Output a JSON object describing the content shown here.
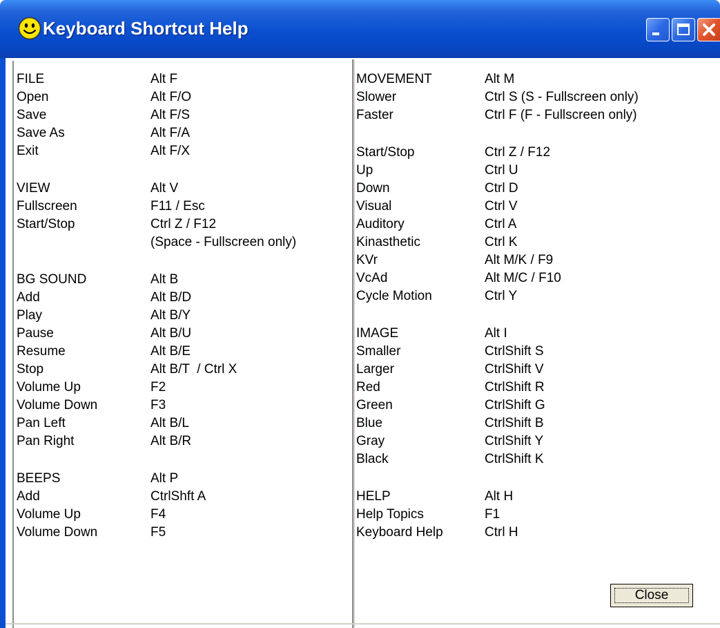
{
  "window": {
    "title": "Keyboard Shortcut Help"
  },
  "buttons": {
    "close_label": "Close"
  },
  "left_column": [
    {
      "name": "FILE",
      "key": "Alt F"
    },
    {
      "name": "Open",
      "key": "Alt F/O"
    },
    {
      "name": "Save",
      "key": "Alt F/S"
    },
    {
      "name": "Save As",
      "key": "Alt F/A"
    },
    {
      "name": "Exit",
      "key": "Alt F/X"
    },
    {
      "name": "VIEW",
      "key": "Alt V"
    },
    {
      "name": "Fullscreen",
      "key": "F11 / Esc"
    },
    {
      "name": "Start/Stop",
      "key": "Ctrl Z / F12"
    },
    {
      "name": "",
      "key": "(Space - Fullscreen only)"
    },
    {
      "name": "BG SOUND",
      "key": "Alt B"
    },
    {
      "name": "Add",
      "key": "Alt B/D"
    },
    {
      "name": "Play",
      "key": "Alt B/Y"
    },
    {
      "name": "Pause",
      "key": "Alt B/U"
    },
    {
      "name": "Resume",
      "key": "Alt B/E"
    },
    {
      "name": "Stop",
      "key": "Alt B/T  / Ctrl X"
    },
    {
      "name": "Volume Up",
      "key": "F2"
    },
    {
      "name": "Volume Down",
      "key": "F3"
    },
    {
      "name": "Pan Left",
      "key": "Alt B/L"
    },
    {
      "name": "Pan Right",
      "key": "Alt B/R"
    },
    {
      "name": "BEEPS",
      "key": "Alt P"
    },
    {
      "name": "Add",
      "key": "CtrlShft A"
    },
    {
      "name": "Volume Up",
      "key": "F4"
    },
    {
      "name": "Volume Down",
      "key": "F5"
    }
  ],
  "right_column": [
    {
      "name": "MOVEMENT",
      "key": "Alt M"
    },
    {
      "name": "Slower",
      "key": "Ctrl S (S - Fullscreen only)"
    },
    {
      "name": "Faster",
      "key": "Ctrl F (F - Fullscreen only)"
    },
    {
      "name": "Start/Stop",
      "key": "Ctrl Z / F12"
    },
    {
      "name": "Up",
      "key": "Ctrl U"
    },
    {
      "name": "Down",
      "key": "Ctrl D"
    },
    {
      "name": "Visual",
      "key": "Ctrl V"
    },
    {
      "name": "Auditory",
      "key": "Ctrl A"
    },
    {
      "name": "Kinasthetic",
      "key": "Ctrl K"
    },
    {
      "name": "KVr",
      "key": "Alt M/K / F9"
    },
    {
      "name": "VcAd",
      "key": "Alt M/C / F10"
    },
    {
      "name": "Cycle Motion",
      "key": "Ctrl Y"
    },
    {
      "name": "IMAGE",
      "key": "Alt I"
    },
    {
      "name": "Smaller",
      "key": "CtrlShift S"
    },
    {
      "name": "Larger",
      "key": "CtrlShift V"
    },
    {
      "name": "Red",
      "key": "CtrlShift R"
    },
    {
      "name": "Green",
      "key": "CtrlShift G"
    },
    {
      "name": "Blue",
      "key": "CtrlShift B"
    },
    {
      "name": "Gray",
      "key": "CtrlShift Y"
    },
    {
      "name": "Black",
      "key": "CtrlShift K"
    },
    {
      "name": "HELP",
      "key": "Alt H"
    },
    {
      "name": "Help Topics",
      "key": "F1"
    },
    {
      "name": "Keyboard Help",
      "key": "Ctrl H"
    }
  ]
}
